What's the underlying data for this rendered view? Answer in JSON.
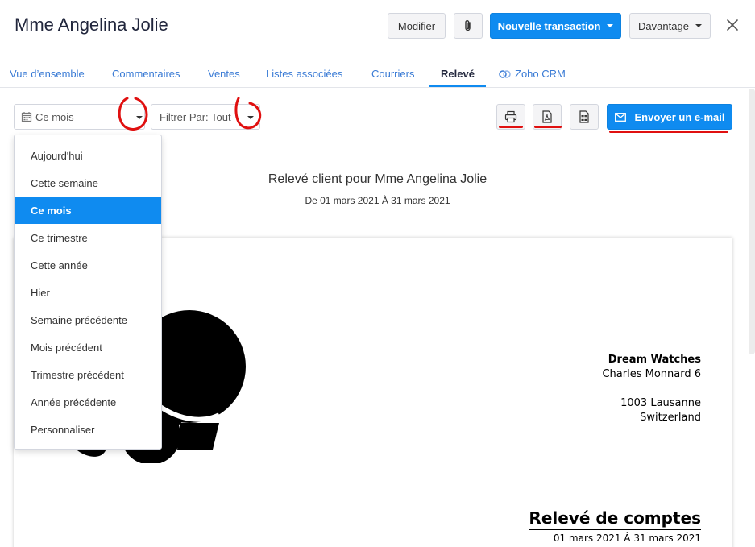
{
  "header": {
    "title": "Mme Angelina Jolie",
    "buttons": {
      "modifier": "Modifier",
      "nouvelle_transaction": "Nouvelle transaction",
      "davantage": "Davantage"
    }
  },
  "tabs": [
    {
      "label": "Vue d’ensemble"
    },
    {
      "label": "Commentaires"
    },
    {
      "label": "Ventes"
    },
    {
      "label": "Listes associées"
    },
    {
      "label": "Courriers"
    },
    {
      "label": "Relevé"
    },
    {
      "label": "Zoho CRM"
    }
  ],
  "active_tab": "Relevé",
  "filters": {
    "period_value": "Ce mois",
    "filter_value": "Filtrer Par: Tout"
  },
  "actions": {
    "send_email_label": "Envoyer un e-mail"
  },
  "statement": {
    "title": "Relevé client pour Mme Angelina Jolie",
    "range": "De 01 mars 2021 À 31 mars 2021"
  },
  "document": {
    "company_name": "Dream Watches",
    "address_line1": "Charles Monnard 6",
    "address_line2": "1003 Lausanne",
    "address_line3": "Switzerland",
    "heading": "Relevé de comptes",
    "range": "01 mars 2021 À 31 mars 2021"
  },
  "period_menu": {
    "items": [
      "Aujourd'hui",
      "Cette semaine",
      "Ce mois",
      "Ce trimestre",
      "Cette année",
      "Hier",
      "Semaine précédente",
      "Mois précédent",
      "Trimestre précédent",
      "Année précédente",
      "Personnaliser"
    ],
    "selected": "Ce mois"
  },
  "colors": {
    "primary": "#0f8bf0",
    "annotation_red": "#e01010",
    "link": "#3a7bd5"
  }
}
